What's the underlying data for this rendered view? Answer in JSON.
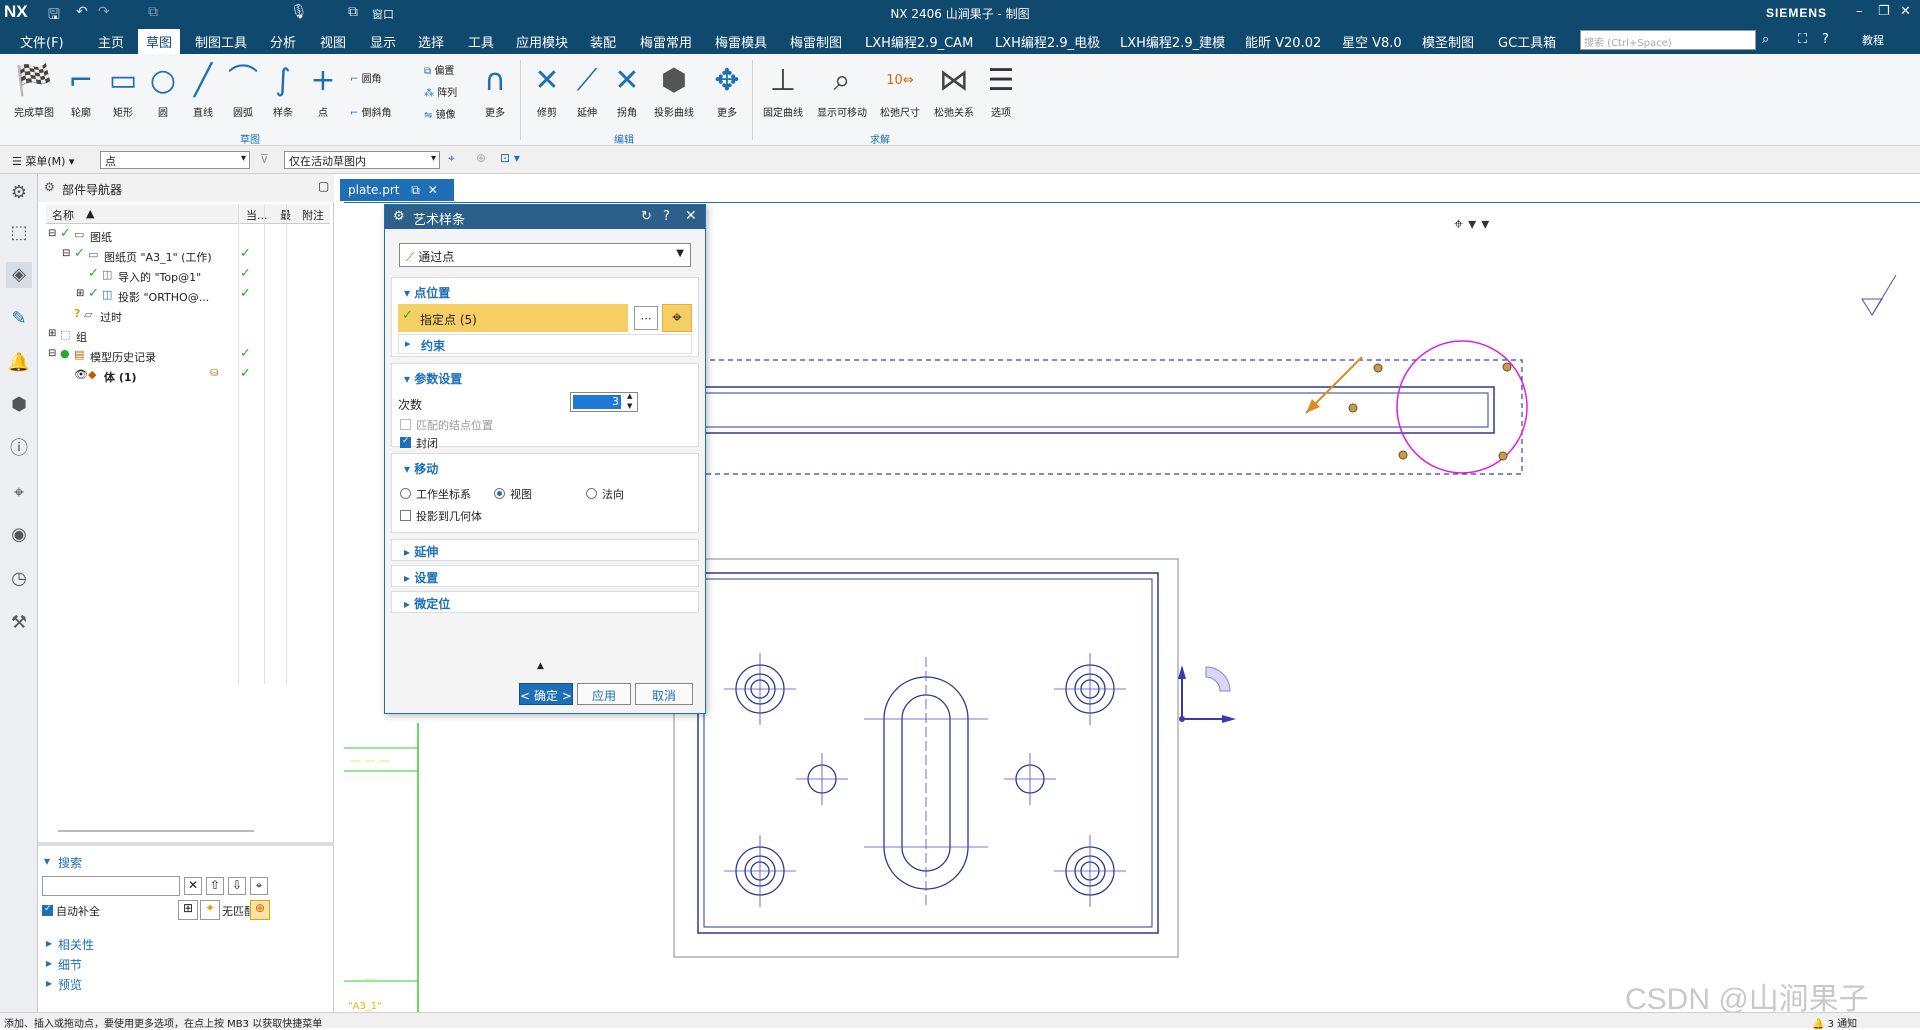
{
  "app": {
    "logo": "NX",
    "window_title": "NX 2406 山涧果子 - 制图",
    "brand": "SIEMENS",
    "window_menu": "窗口"
  },
  "menu_tabs": [
    "文件(F)",
    "主页",
    "草图",
    "制图工具",
    "分析",
    "视图",
    "显示",
    "选择",
    "工具",
    "应用模块",
    "装配",
    "梅雷常用",
    "梅雷模具",
    "梅雷制图",
    "LXH编程2.9_CAM",
    "LXH编程2.9_电极",
    "LXH编程2.9_建模",
    "能昕 V20.02",
    "星空 V8.0",
    "模圣制图",
    "GC工具箱"
  ],
  "search_placeholder": "搜索 (Ctrl+Space)",
  "help_label": "教程",
  "ribbon": {
    "buttons": [
      "完成草图",
      "轮廓",
      "矩形",
      "圆",
      "直线",
      "圆弧",
      "样条",
      "点"
    ],
    "small_buttons": [
      "圆角",
      "倒斜角",
      "偏置",
      "阵列",
      "镜像"
    ],
    "more_label": "更多",
    "edit_buttons": [
      "修剪",
      "延伸",
      "拐角",
      "投影曲线"
    ],
    "solve_buttons": [
      "固定曲线",
      "显示可移动",
      "松弛尺寸",
      "松弛关系",
      "选项"
    ],
    "groups": [
      "草图",
      "编辑",
      "求解"
    ],
    "dim_tag": "10"
  },
  "selbar": {
    "menu_label": "菜单(M)",
    "filter": "点",
    "scope": "仅在活动草图内"
  },
  "navigator": {
    "title": "部件导航器",
    "columns": [
      "名称",
      "当...",
      "最",
      "附注"
    ],
    "nodes": [
      {
        "label": "图纸"
      },
      {
        "label": "图纸页 \"A3_1\" (工作)"
      },
      {
        "label": "导入的 \"Top@1\""
      },
      {
        "label": "投影 \"ORTHO@..."
      },
      {
        "label": "过时"
      },
      {
        "label": "组"
      },
      {
        "label": "模型历史记录"
      },
      {
        "label": "体 (1)"
      }
    ],
    "search_title": "搜索",
    "autocomplete": "自动补全",
    "no_match": "无匹配",
    "sections": [
      "相关性",
      "细节",
      "预览"
    ]
  },
  "doc_tab": "plate.prt",
  "dialog": {
    "title": "艺术样条",
    "type": "通过点",
    "sec_points": "点位置",
    "specify_point": "指定点 (5)",
    "constraint": "约束",
    "sec_params": "参数设置",
    "degree_label": "次数",
    "degree_value": "3",
    "match_knots": "匹配的结点位置",
    "closed": "封闭",
    "sec_move": "移动",
    "move_options": [
      "工作坐标系",
      "视图",
      "法向"
    ],
    "project": "投影到几何体",
    "sec_extend": "延伸",
    "sec_settings": "设置",
    "sec_micro": "微定位",
    "ok": "< 确定 >",
    "apply": "应用",
    "cancel": "取消"
  },
  "drawing": {
    "sheet_label": "\"A3_1\""
  },
  "status": {
    "prompt": "添加、插入或拖动点，要使用更多选项，在点上按 MB3 以获取快捷菜单",
    "notifications": "3 通知"
  },
  "watermark": "CSDN @山涧果子",
  "colors": {
    "titlebar": "#0f4a6e",
    "accent": "#1e6fb5",
    "spline": "#e020e0",
    "highlight": "#f5cf63"
  }
}
